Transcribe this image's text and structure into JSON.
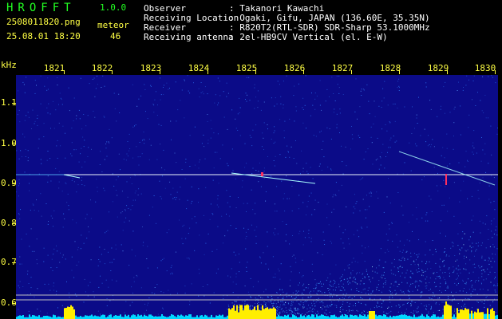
{
  "header": {
    "logo": "HROFFT",
    "version": "1.0.0",
    "filename": "2508011820.png",
    "datetime": "25.08.01 18:20",
    "meteor_label": "meteor",
    "meteor_count": "46",
    "fields": [
      {
        "label": "Observer",
        "value": ": Takanori Kawachi"
      },
      {
        "label": "Receiving Location",
        "value": ": Ogaki, Gifu, JAPAN (136.60E, 35.35N)"
      },
      {
        "label": "Receiver",
        "value": ": R820T2(RTL-SDR) SDR-Sharp 53.1000MHz"
      },
      {
        "label": "Receiving antenna",
        "value": ": 2el-HB9CV Vertical (el. E-W)"
      }
    ]
  },
  "plot": {
    "y_unit": "kHz",
    "x_ticks": [
      "1821",
      "1822",
      "1823",
      "1824",
      "1825",
      "1826",
      "1827",
      "1828",
      "1829",
      "1830"
    ],
    "y_ticks": [
      "1.1",
      "1.0",
      "0.9",
      "0.8",
      "0.7",
      "0.6"
    ],
    "colors": {
      "background": "#0b0b88",
      "carrier": "#ffffff",
      "noise": "#2f7fff",
      "meter": "#ffee00",
      "meter_base": "#00d8ff"
    }
  }
}
